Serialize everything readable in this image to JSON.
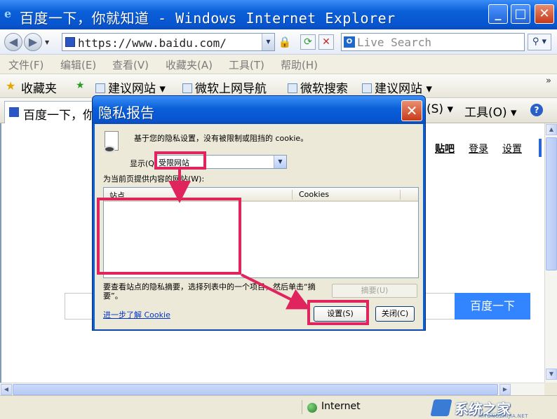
{
  "window": {
    "title": "百度一下，你就知道 - Windows Internet Explorer",
    "min": "_",
    "max": "□",
    "close": "✕"
  },
  "address_bar": {
    "url": "https://www.baidu.com/",
    "search_placeholder": "Live Search"
  },
  "menu": [
    "文件(F)",
    "编辑(E)",
    "查看(V)",
    "收藏夹(A)",
    "工具(T)",
    "帮助(H)"
  ],
  "favorites_bar": {
    "label": "收藏夹",
    "items": [
      "建议网站 ▾",
      "微软上网导航",
      "微软搜索",
      "建议网站 ▾"
    ]
  },
  "tab_bar": {
    "tab_title": "百度一下，你就知道",
    "safety_menu": "(S) ▾",
    "tools_menu": "工具(O) ▾"
  },
  "page": {
    "top_links": [
      "贴吧",
      "登录",
      "设置"
    ],
    "search_button": "百度一下"
  },
  "status_bar": {
    "zone": "Internet"
  },
  "watermark": {
    "title": "系统之家",
    "subtitle": "XITONGZHIJIA.NET"
  },
  "dialog": {
    "title": "隐私报告",
    "message": "基于您的隐私设置，没有被限制或阻挡的 cookie。",
    "show_label": "显示(Q):",
    "show_value": "受限网站",
    "list_label": "为当前页提供内容的网站(W):",
    "columns": [
      "站点",
      "Cookies"
    ],
    "rows": [],
    "hint": "要查看站点的隐私摘要，选择列表中的一个项目，然后单击“摘要”。",
    "summary_button": "摘要(U)",
    "learn_more_link": "进一步了解 Cookie",
    "settings_button": "设置(S)",
    "close_button": "关闭(C)"
  },
  "colors": {
    "xp_blue": "#0a5fd8",
    "highlight": "#e0245e",
    "baidu_blue": "#3385ff"
  }
}
